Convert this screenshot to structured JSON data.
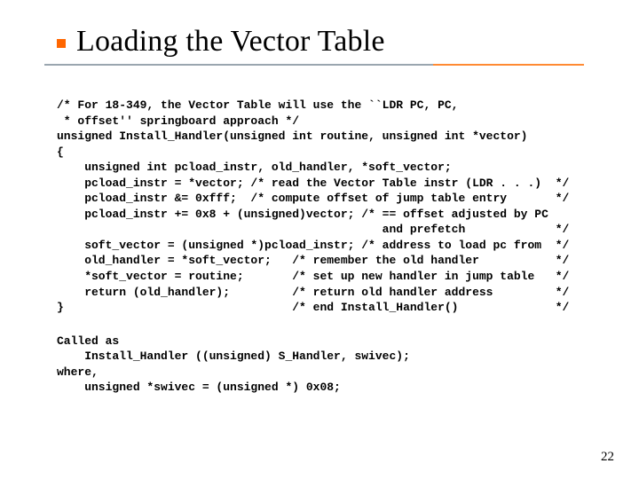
{
  "slide": {
    "title": "Loading the Vector Table",
    "code": "/* For 18-349, the Vector Table will use the ``LDR PC, PC,\n * offset'' springboard approach */\nunsigned Install_Handler(unsigned int routine, unsigned int *vector)\n{\n    unsigned int pcload_instr, old_handler, *soft_vector;\n    pcload_instr = *vector; /* read the Vector Table instr (LDR . . .)  */\n    pcload_instr &= 0xfff;  /* compute offset of jump table entry       */\n    pcload_instr += 0x8 + (unsigned)vector; /* == offset adjusted by PC\n                                               and prefetch             */\n    soft_vector = (unsigned *)pcload_instr; /* address to load pc from  */\n    old_handler = *soft_vector;   /* remember the old handler           */\n    *soft_vector = routine;       /* set up new handler in jump table   */\n    return (old_handler);         /* return old handler address         */\n}                                 /* end Install_Handler()              */",
    "annotation": "Called as\n    Install_Handler ((unsigned) S_Handler, swivec);\nwhere,\n    unsigned *swivec = (unsigned *) 0x08;",
    "page_number": "22"
  }
}
